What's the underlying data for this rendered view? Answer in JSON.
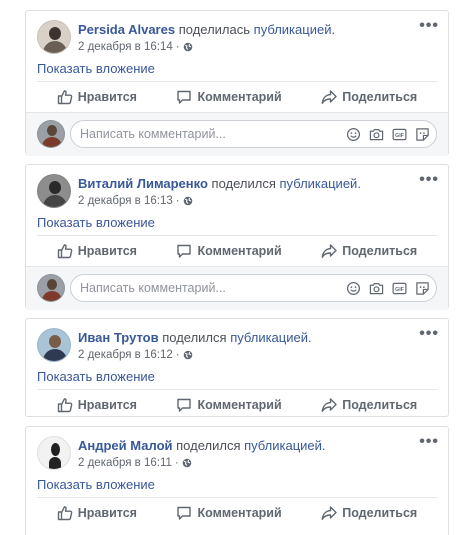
{
  "posts": [
    {
      "author": "Persida Alvares",
      "shared_text": "поделилась",
      "link_text": "публикацией.",
      "date": "2 декабря в 16:14",
      "more_label": "•••",
      "attachment_label": "Показать вложение",
      "has_comment_box": true
    },
    {
      "author": "Виталий Лимаренко",
      "shared_text": "поделился",
      "link_text": "публикацией.",
      "date": "2 декабря в 16:13",
      "more_label": "•••",
      "attachment_label": "Показать вложение",
      "has_comment_box": true
    },
    {
      "author": "Иван Трутов",
      "shared_text": "поделился",
      "link_text": "публикацией.",
      "date": "2 декабря в 16:12",
      "more_label": "•••",
      "attachment_label": "Показать вложение",
      "has_comment_box": false
    },
    {
      "author": "Андрей Малой",
      "shared_text": "поделился",
      "link_text": "публикацией.",
      "date": "2 декабря в 16:11",
      "more_label": "•••",
      "attachment_label": "Показать вложение",
      "has_comment_box": false
    }
  ],
  "actions": {
    "like_label": "Нравится",
    "comment_label": "Комментарий",
    "share_label": "Поделиться"
  },
  "comment_box": {
    "placeholder": "Написать комментарий...",
    "icons": [
      "emoji-icon",
      "camera-icon",
      "gif-icon",
      "sticker-icon"
    ]
  },
  "icons": {
    "privacy": "globe-icon",
    "like": "thumbs-up-icon",
    "comment": "speech-bubble-icon",
    "share": "share-arrow-icon",
    "more": "more-options-icon"
  },
  "colors": {
    "link": "#385898",
    "action_text": "#606770",
    "meta_text": "#616770",
    "border": "#dddfe2",
    "comment_bg": "#f5f6f7"
  }
}
